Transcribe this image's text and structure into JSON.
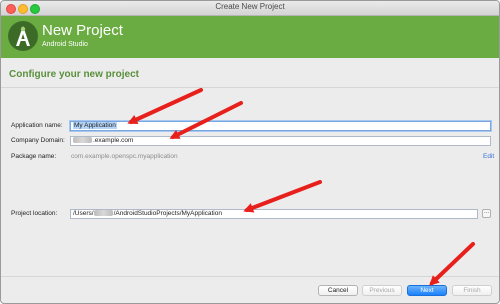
{
  "window": {
    "title": "Create New Project"
  },
  "header": {
    "title": "New Project",
    "subtitle": "Android Studio"
  },
  "section": {
    "title": "Configure your new project"
  },
  "form": {
    "app_name_label": "Application name:",
    "app_name_value": "My Application",
    "company_domain_label": "Company Domain:",
    "company_domain_value": ".example.com",
    "package_name_label": "Package name:",
    "package_name_value": "com.example.openspc.myapplication",
    "edit_link": "Edit",
    "project_location_label": "Project location:",
    "project_location_prefix": "/Users/",
    "project_location_suffix": "/AndroidStudioProjects/MyApplication",
    "browse_label": "..."
  },
  "buttons": {
    "cancel": "Cancel",
    "previous": "Previous",
    "next": "Next",
    "finish": "Finish"
  },
  "colors": {
    "header_bg": "#6aac42",
    "section_title": "#5a8f3c",
    "annotation_arrow": "#e8201b",
    "primary_button": "#1a82fb"
  },
  "icons": {
    "logo": "android-studio-logo",
    "annotation": "red-arrow"
  }
}
